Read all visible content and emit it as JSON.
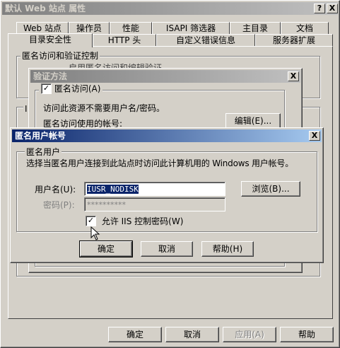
{
  "main": {
    "title": "默认 Web 站点 属性",
    "title_buttons": [
      "?",
      "X"
    ],
    "tabs_back": [
      "Web 站点",
      "操作员",
      "性能",
      "ISAPI 筛选器",
      "主目录",
      "文档"
    ],
    "tabs_front": [
      "目录安全性",
      "HTTP 头",
      "自定义错误信息",
      "服务器扩展"
    ],
    "group_title": "匿名访问和验证控制",
    "group_text_partial": "启用匿名访问和编辑验证",
    "side_label": "I",
    "buttons": {
      "ok": "确定",
      "cancel": "取消",
      "apply": "应用(A)",
      "help": "帮助"
    }
  },
  "auth": {
    "title": "验证方法",
    "close": "X",
    "anon_checkbox": "匿名访问(A)",
    "anon_checked": true,
    "desc": "访问此资源不需要用户名/密码。",
    "account_label": "匿名访问使用的帐号:",
    "edit_button": "编辑(E)..."
  },
  "anon": {
    "title": "匿名用户帐号",
    "close": "X",
    "group_title": "匿名用户",
    "desc": "选择当匿名用户连接到此站点时访问此计算机用的 Windows 用户帐号。",
    "username_label": "用户名(U):",
    "username_value": "IUSR_NODISK",
    "browse_button": "浏览(B)...",
    "password_label": "密码(P):",
    "password_value": "**********",
    "allow_iis_checkbox": "允许 IIS 控制密码(W)",
    "allow_iis_checked": true,
    "buttons": {
      "ok": "确定",
      "cancel": "取消",
      "help": "帮助(H)"
    }
  }
}
